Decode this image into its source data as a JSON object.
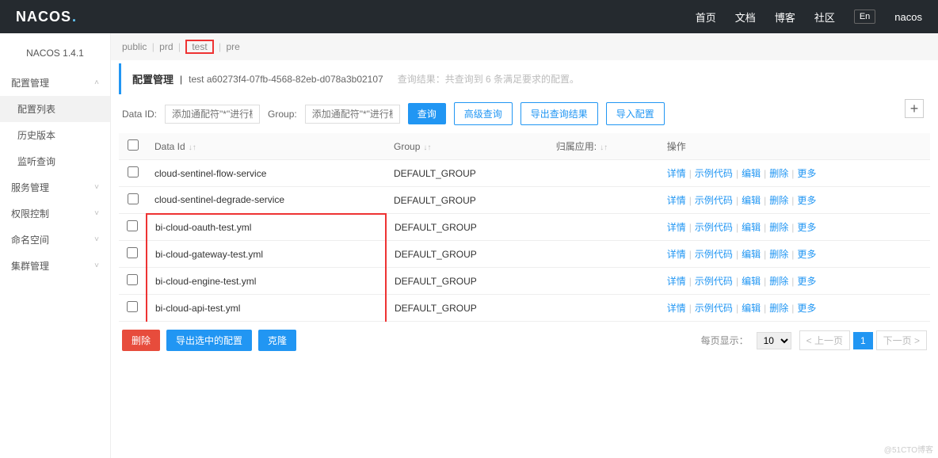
{
  "header": {
    "logo": "NACOS",
    "nav": {
      "home": "首页",
      "docs": "文档",
      "blog": "博客",
      "community": "社区",
      "lang": "En",
      "user": "nacos"
    }
  },
  "sidebar": {
    "version": "NACOS 1.4.1",
    "groups": [
      {
        "label": "配置管理",
        "open": true,
        "children": [
          {
            "label": "配置列表",
            "active": true
          },
          {
            "label": "历史版本"
          },
          {
            "label": "监听查询"
          }
        ]
      },
      {
        "label": "服务管理"
      },
      {
        "label": "权限控制"
      },
      {
        "label": "命名空间"
      },
      {
        "label": "集群管理"
      }
    ]
  },
  "tabs": {
    "items": [
      "public",
      "prd",
      "test",
      "pre"
    ],
    "active": "test"
  },
  "breadcrumb": {
    "title": "配置管理",
    "namespace": "test a60273f4-07fb-4568-82eb-d078a3b02107",
    "hint": "查询结果：共查询到 6 条满足要求的配置。"
  },
  "query": {
    "dataid_label": "Data ID:",
    "dataid_placeholder": "添加通配符\"*\"进行模糊查询",
    "group_label": "Group:",
    "group_placeholder": "添加通配符\"*\"进行模糊查询",
    "search": "查询",
    "advanced": "高级查询",
    "export": "导出查询结果",
    "import": "导入配置"
  },
  "table": {
    "cols": {
      "dataid": "Data Id",
      "group": "Group",
      "app": "归属应用:",
      "ops": "操作"
    },
    "rows": [
      {
        "dataid": "cloud-sentinel-flow-service",
        "group": "DEFAULT_GROUP",
        "hl": false
      },
      {
        "dataid": "cloud-sentinel-degrade-service",
        "group": "DEFAULT_GROUP",
        "hl": false
      },
      {
        "dataid": "bi-cloud-oauth-test.yml",
        "group": "DEFAULT_GROUP",
        "hl": true
      },
      {
        "dataid": "bi-cloud-gateway-test.yml",
        "group": "DEFAULT_GROUP",
        "hl": true
      },
      {
        "dataid": "bi-cloud-engine-test.yml",
        "group": "DEFAULT_GROUP",
        "hl": true
      },
      {
        "dataid": "bi-cloud-api-test.yml",
        "group": "DEFAULT_GROUP",
        "hl": true
      }
    ],
    "actions": {
      "detail": "详情",
      "sample": "示例代码",
      "edit": "编辑",
      "delete": "删除",
      "more": "更多"
    }
  },
  "footer": {
    "delete": "删除",
    "export_sel": "导出选中的配置",
    "clone": "克隆",
    "page_label": "每页显示：",
    "page_size": "10",
    "prev": "< 上一页",
    "page": "1",
    "next": "下一页 >"
  },
  "watermark": "@51CTO博客"
}
